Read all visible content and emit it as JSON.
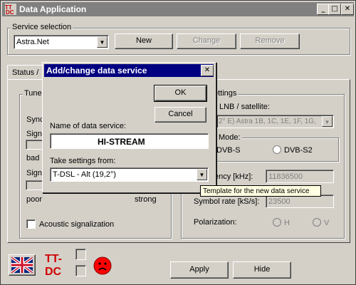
{
  "window": {
    "title": "Data Application",
    "icon": "dvb-app-icon",
    "buttons": [
      "_",
      "□",
      "✕"
    ]
  },
  "service_selection": {
    "label": "Service selection",
    "selected": "Astra.Net",
    "new_label": "New",
    "change_label": "Change",
    "remove_label": "Remove"
  },
  "tabs": {
    "first": "Status /"
  },
  "tuner": {
    "label": "Tuner",
    "sync": "Sync",
    "signal1": "Sign",
    "bad": "bad",
    "signal2": "Sign",
    "poor": "poor",
    "strong": "strong",
    "acoustic": "Acoustic signalization"
  },
  "settings": {
    "label": "ettings",
    "lnb_label": "LNB / satellite:",
    "lnb_value": "2° E) Astra 1B, 1C, 1E, 1F, 1G,",
    "mode_label": "Mode:",
    "mode_dvbs": "DVB-S",
    "mode_dvbs2": "DVB-S2",
    "freq_label": "ency [kHz]:",
    "freq_value": "11836500",
    "symbol_label": "Symbol rate [kS/s]:",
    "symbol_value": "23500",
    "pol_label": "Polarization:",
    "pol_h": "H",
    "pol_v": "V"
  },
  "bottom": {
    "apply_label": "Apply",
    "hide_label": "Hide",
    "logo": "TT-DC"
  },
  "dialog": {
    "title": "Add/change data service",
    "ok_label": "OK",
    "cancel_label": "Cancel",
    "name_label": "Name of data service:",
    "name_value": "HI-STREAM",
    "take_label": "Take settings from:",
    "take_value": "T-DSL - Alt (19,2°)"
  },
  "tooltip": {
    "text": "Template for the new data service"
  },
  "colors": {
    "title_active": "#000080",
    "title_inactive": "#808080",
    "face": "#d4d0c8",
    "tooltip_bg": "#ffffe1"
  }
}
